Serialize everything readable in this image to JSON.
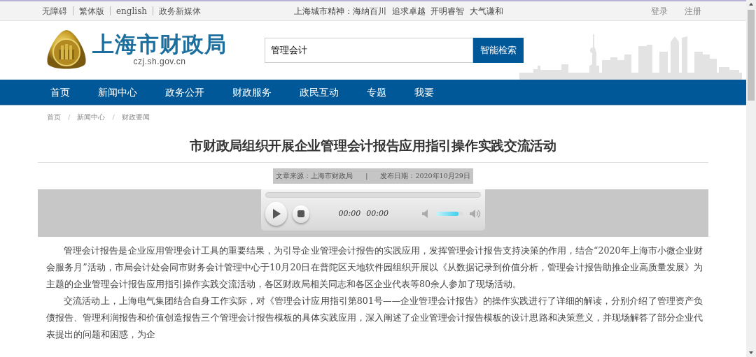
{
  "top_bar": {
    "links": [
      "无障碍",
      "繁体版",
      "english",
      "政务新媒体"
    ],
    "motto": "上海城市精神：海纳百川  追求卓越  开明睿智  大气谦和",
    "account_links": [
      "登录",
      "注册"
    ]
  },
  "header": {
    "site_name": "上海市财政局",
    "domain": "czj.sh.gov.cn",
    "search": {
      "value": "管理会计",
      "button": "智能检索"
    }
  },
  "nav": {
    "items": [
      {
        "label": "首页",
        "selected": false
      },
      {
        "label": "新闻中心",
        "selected": false
      },
      {
        "label": "政务公开",
        "selected": false
      },
      {
        "label": "财政服务",
        "selected": false
      },
      {
        "label": "政民互动",
        "selected": false
      },
      {
        "label": "专题",
        "selected": false
      },
      {
        "label": "我要",
        "selected": false
      }
    ]
  },
  "breadcrumb": [
    "首页",
    "新闻中心",
    "财政要闻"
  ],
  "breadcrumb_separator": "/",
  "meta_separator": "|",
  "article": {
    "title": "市财政局组织开展企业管理会计报告应用指引操作实践交流活动",
    "source": "文章来源：上海市财政局",
    "date": "发布日期：2020年10月29日",
    "player": {
      "current_time": "00:00",
      "duration": "00:00",
      "progress": {
        "level": 0
      },
      "volume": {
        "level": 0.8
      }
    },
    "paragraphs": [
      "管理会计报告是企业应用管理会计工具的重要结果，为引导企业管理会计报告的实践应用，发挥管理会计报告支持决策的作用，结合“2020年上海市小微企业财会服务月”活动，市局会计处会同市财务会计管理中心于10月20日在普陀区天地软件园组织开展以《从数据记录到价值分析，管理会计报告助推企业高质量发展》为主题的企业管理会计报告应用指引操作实践交流活动，各区财政局相关同志和各区企业代表等80余人参加了现场活动。",
      "交流活动上，上海电气集团结合自身工作实际，对《管理会计应用指引第801号——企业管理会计报告》的操作实践进行了详细的解读，分别介绍了管理资产负债报告、管理利润报告和价值创造报告三个管理会计报告模板的具体实践应用，深入阐述了企业管理会计报告模板的设计思路和决策意义，并现场解答了部分企业代表提出的问题和困惑，为企"
    ]
  }
}
